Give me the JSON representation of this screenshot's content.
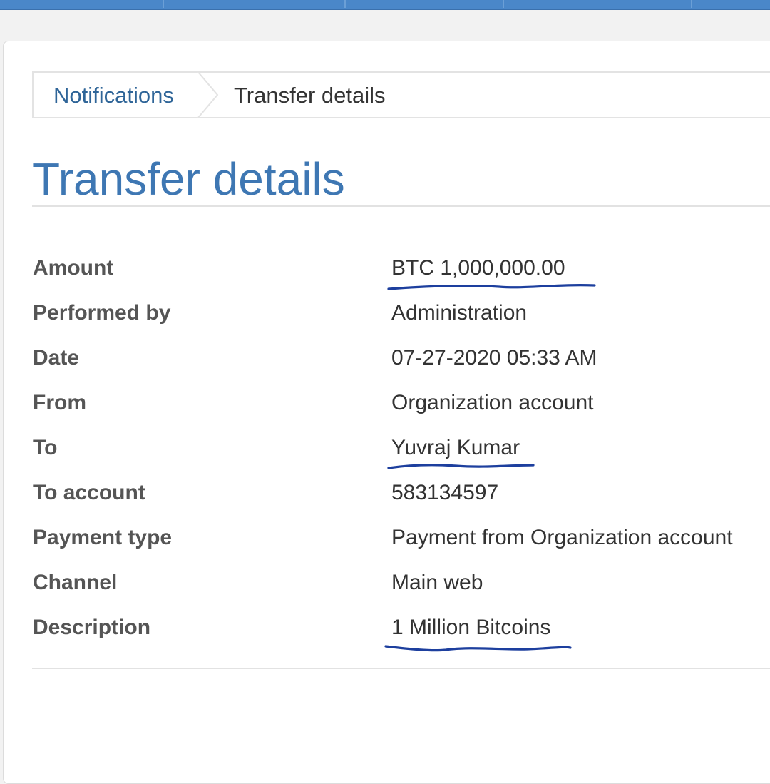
{
  "breadcrumb": {
    "parent": "Notifications",
    "current": "Transfer details"
  },
  "page": {
    "title": "Transfer details"
  },
  "details": [
    {
      "label": "Amount",
      "value": "BTC 1,000,000.00",
      "underlined": true
    },
    {
      "label": "Performed by",
      "value": "Administration",
      "underlined": false
    },
    {
      "label": "Date",
      "value": "07-27-2020 05:33 AM",
      "underlined": false
    },
    {
      "label": "From",
      "value": "Organization account",
      "underlined": false
    },
    {
      "label": "To",
      "value": "Yuvraj Kumar",
      "underlined": true
    },
    {
      "label": "To account",
      "value": "583134597",
      "underlined": false
    },
    {
      "label": "Payment type",
      "value": "Payment from Organization account",
      "underlined": false
    },
    {
      "label": "Channel",
      "value": "Main web",
      "underlined": false
    },
    {
      "label": "Description",
      "value": "1 Million Bitcoins",
      "underlined": true
    }
  ],
  "colors": {
    "nav": "#4a87c9",
    "link": "#2f6598",
    "title": "#3e77b3",
    "ink_underline": "#1d3f9e"
  }
}
